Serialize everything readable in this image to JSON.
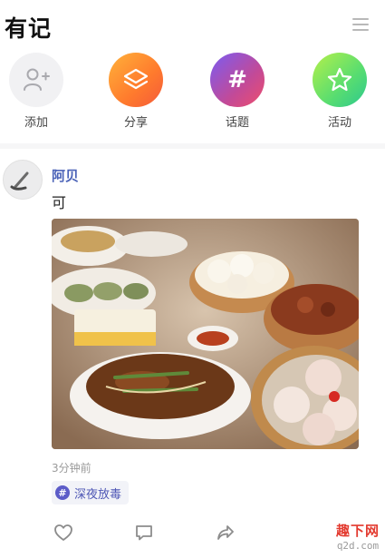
{
  "header": {
    "title": "有记",
    "menu_icon": "menu-icon"
  },
  "actions": [
    {
      "label": "添加",
      "icon": "add-user-icon"
    },
    {
      "label": "分享",
      "icon": "layers-icon"
    },
    {
      "label": "话题",
      "icon": "hash-icon",
      "glyph": "#"
    },
    {
      "label": "活动",
      "icon": "star-icon"
    }
  ],
  "post": {
    "author": "阿贝",
    "text": "可",
    "image_alt": "dim-sum-photo",
    "time": "3分钟前",
    "tag": {
      "hash": "#",
      "label": "深夜放毒"
    }
  },
  "watermark": {
    "line1": "趣下网",
    "line2": "q2d.com"
  },
  "colors": {
    "author": "#4b63b8",
    "tag_text": "#4e57b5",
    "tag_icon_bg": "#5c5cc8"
  }
}
